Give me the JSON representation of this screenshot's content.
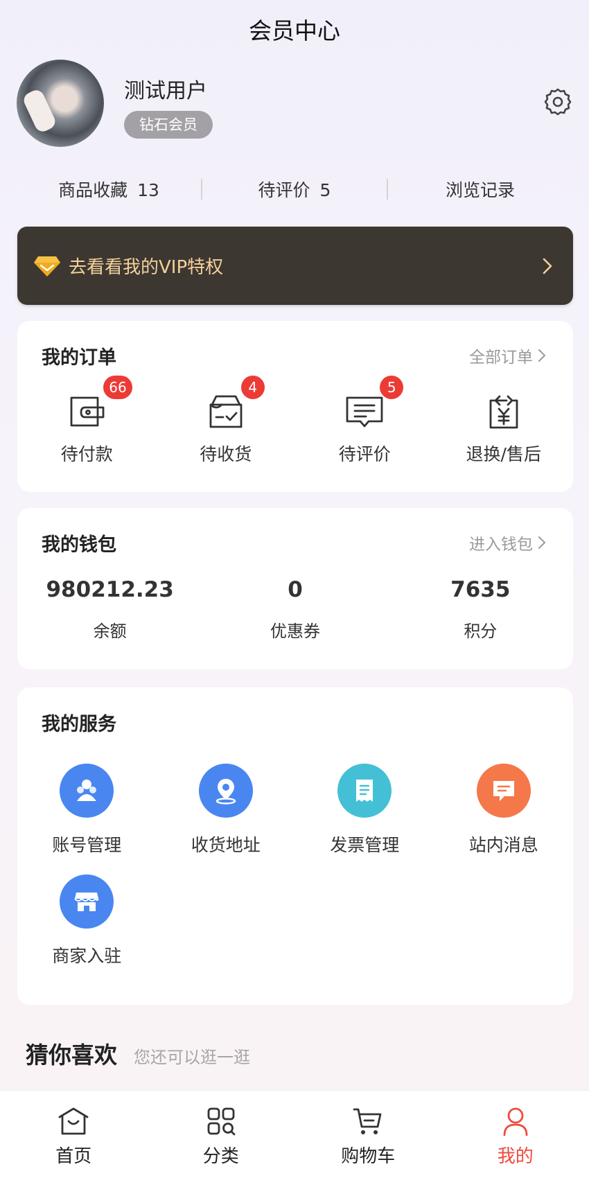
{
  "header": {
    "title": "会员中心"
  },
  "profile": {
    "name": "测试用户",
    "level": "钻石会员"
  },
  "stats": [
    {
      "label": "商品收藏",
      "count": "13"
    },
    {
      "label": "待评价",
      "count": "5"
    },
    {
      "label": "浏览记录"
    }
  ],
  "vip": {
    "text": "去看看我的VIP特权"
  },
  "orders": {
    "title": "我的订单",
    "link": "全部订单",
    "items": [
      {
        "label": "待付款",
        "badge": "66",
        "icon": "wallet-icon"
      },
      {
        "label": "待收货",
        "badge": "4",
        "icon": "box-check-icon"
      },
      {
        "label": "待评价",
        "badge": "5",
        "icon": "comment-icon"
      },
      {
        "label": "退换/售后",
        "icon": "refund-icon"
      }
    ]
  },
  "wallet": {
    "title": "我的钱包",
    "link": "进入钱包",
    "items": [
      {
        "value": "980212.23",
        "label": "余额"
      },
      {
        "value": "0",
        "label": "优惠券"
      },
      {
        "value": "7635",
        "label": "积分"
      }
    ]
  },
  "services": {
    "title": "我的服务",
    "items": [
      {
        "label": "账号管理",
        "icon": "account-icon",
        "color": "#4a86f0"
      },
      {
        "label": "收货地址",
        "icon": "location-pin-icon",
        "color": "#4a86f0"
      },
      {
        "label": "发票管理",
        "icon": "invoice-icon",
        "color": "#43c0d6"
      },
      {
        "label": "站内消息",
        "icon": "message-icon",
        "color": "#f4784a"
      },
      {
        "label": "商家入驻",
        "icon": "store-icon",
        "color": "#4a86f0"
      }
    ]
  },
  "guess": {
    "title": "猜你喜欢",
    "subtitle": "您还可以逛一逛"
  },
  "tabbar": [
    {
      "label": "首页",
      "icon": "home-icon"
    },
    {
      "label": "分类",
      "icon": "category-icon"
    },
    {
      "label": "购物车",
      "icon": "cart-icon"
    },
    {
      "label": "我的",
      "icon": "user-icon",
      "active": true
    }
  ],
  "colors": {
    "accent": "#ef4a3c",
    "badge": "#ec3b35",
    "vip_bg": "#3d3731",
    "vip_text": "#f3d19a"
  }
}
